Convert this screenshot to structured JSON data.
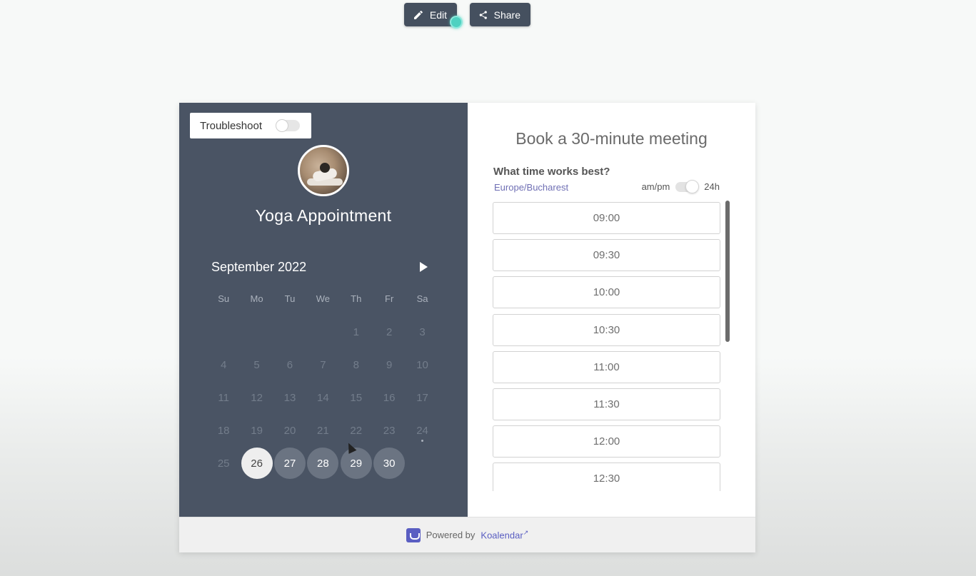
{
  "toolbar": {
    "edit_label": "Edit",
    "share_label": "Share"
  },
  "left": {
    "troubleshoot_label": "Troubleshoot",
    "event_title": "Yoga Appointment",
    "month": "September 2022",
    "weekdays": [
      "Su",
      "Mo",
      "Tu",
      "We",
      "Th",
      "Fr",
      "Sa"
    ],
    "days": [
      {
        "d": "",
        "s": "empty"
      },
      {
        "d": "",
        "s": "empty"
      },
      {
        "d": "",
        "s": "empty"
      },
      {
        "d": "",
        "s": "empty"
      },
      {
        "d": "1",
        "s": "off"
      },
      {
        "d": "2",
        "s": "off"
      },
      {
        "d": "3",
        "s": "off"
      },
      {
        "d": "4",
        "s": "off"
      },
      {
        "d": "5",
        "s": "off"
      },
      {
        "d": "6",
        "s": "off"
      },
      {
        "d": "7",
        "s": "off"
      },
      {
        "d": "8",
        "s": "off"
      },
      {
        "d": "9",
        "s": "off"
      },
      {
        "d": "10",
        "s": "off"
      },
      {
        "d": "11",
        "s": "off"
      },
      {
        "d": "12",
        "s": "off"
      },
      {
        "d": "13",
        "s": "off"
      },
      {
        "d": "14",
        "s": "off"
      },
      {
        "d": "15",
        "s": "off"
      },
      {
        "d": "16",
        "s": "off"
      },
      {
        "d": "17",
        "s": "off"
      },
      {
        "d": "18",
        "s": "off"
      },
      {
        "d": "19",
        "s": "off"
      },
      {
        "d": "20",
        "s": "off"
      },
      {
        "d": "21",
        "s": "off"
      },
      {
        "d": "22",
        "s": "off"
      },
      {
        "d": "23",
        "s": "off"
      },
      {
        "d": "24",
        "s": "today"
      },
      {
        "d": "25",
        "s": "off"
      },
      {
        "d": "26",
        "s": "selected"
      },
      {
        "d": "27",
        "s": "avail"
      },
      {
        "d": "28",
        "s": "avail"
      },
      {
        "d": "29",
        "s": "avail"
      },
      {
        "d": "30",
        "s": "avail"
      }
    ]
  },
  "right": {
    "heading": "Book a 30-minute meeting",
    "question": "What time works best?",
    "timezone": "Europe/Bucharest",
    "format_ampm": "am/pm",
    "format_24h": "24h",
    "slots": [
      "09:00",
      "09:30",
      "10:00",
      "10:30",
      "11:00",
      "11:30",
      "12:00",
      "12:30"
    ]
  },
  "footer": {
    "powered_by": "Powered by",
    "brand": "Koalendar"
  },
  "colors": {
    "panel": "#4a5464",
    "accent": "#5a5ec2",
    "toolbar": "#45505f"
  }
}
